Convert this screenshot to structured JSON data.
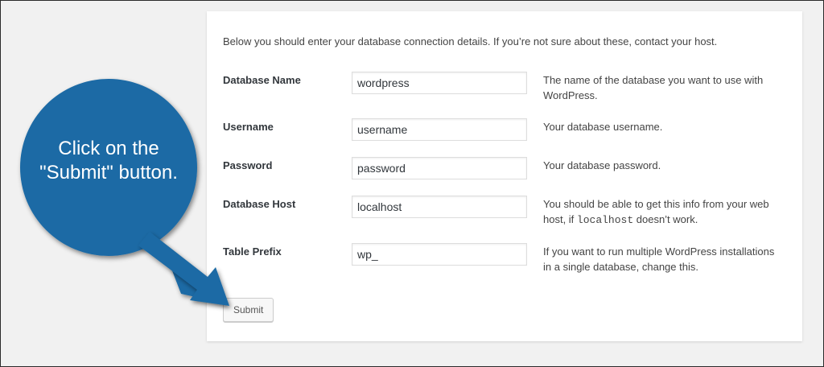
{
  "intro": "Below you should enter your database connection details. If you’re not sure about these, contact your host.",
  "fields": [
    {
      "label": "Database Name",
      "value": "wordpress",
      "desc": "The name of the database you want to use with WordPress."
    },
    {
      "label": "Username",
      "value": "username",
      "desc": "Your database username."
    },
    {
      "label": "Password",
      "value": "password",
      "desc": "Your database password."
    },
    {
      "label": "Database Host",
      "value": "localhost",
      "desc_pre": "You should be able to get this info from your web host, if ",
      "desc_code": "localhost",
      "desc_post": " doesn’t work."
    },
    {
      "label": "Table Prefix",
      "value": "wp_",
      "desc": "If you want to run multiple WordPress installations in a single database, change this."
    }
  ],
  "submit_label": "Submit",
  "callout": {
    "text": "Click on the \"Submit\" button.",
    "color": "#1b6aa5"
  }
}
